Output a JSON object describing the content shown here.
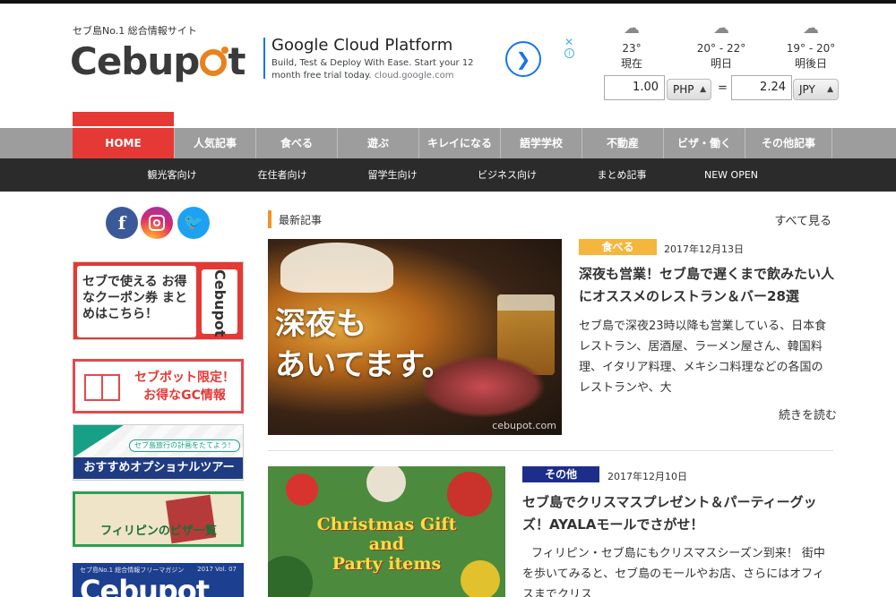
{
  "header": {
    "tagline": "セブ島No.1 総合情報サイト",
    "logo_pre": "Cebup",
    "logo_post": "t"
  },
  "ad": {
    "title": "Google Cloud Platform",
    "body": "Build, Test & Deploy With Ease. Start your 12 month free trial today.",
    "url": "cloud.google.com",
    "arrow_icon": "chevron-right-icon",
    "close_label": "✕",
    "info_label": "i"
  },
  "weather": [
    {
      "icon": "cloud-rain-icon",
      "temp": "23°",
      "label": "現在"
    },
    {
      "icon": "cloud-rain-icon",
      "temp": "20° - 22°",
      "label": "明日"
    },
    {
      "icon": "cloud-thunder-icon",
      "temp": "19° - 20°",
      "label": "明後日"
    }
  ],
  "converter": {
    "from_value": "1.00",
    "from_currency": "PHP",
    "equals": "=",
    "to_value": "2.24",
    "to_currency": "JPY"
  },
  "main_nav": [
    "HOME",
    "人気記事",
    "食べる",
    "遊ぶ",
    "キレイになる",
    "語学学校",
    "不動産",
    "ビザ・働く",
    "その他記事"
  ],
  "sub_nav": [
    "観光客向け",
    "在住者向け",
    "留学生向け",
    "ビジネス向け",
    "まとめ記事",
    "NEW OPEN"
  ],
  "sidebar": {
    "social": {
      "facebook": "f",
      "twitter": "🐦"
    },
    "coupon_text": "セブで使える お得なクーポン券 まとめはこちら！",
    "coupon_vert": "Cebupot",
    "gc_text": "セブポット限定！ お得なGC情報",
    "tour_pill": "セブ島旅行の計画をたてよう！",
    "tour_text": "おすすめオプショナルツアー",
    "visa_text": "フィリピンのビザ一覧",
    "mag_small": "セブ島No.1 総合情報フリーマガジン",
    "mag_vol": "2017 Vol. 07",
    "mag_title": "Cebupot"
  },
  "section": {
    "label": "最新記事",
    "see_all": "すべて見る"
  },
  "articles": [
    {
      "category": "食べる",
      "category_color": "#f4b63c",
      "date": "2017年12月13日",
      "title": "深夜も営業！セブ島で遅くまで飲みたい人にオススメのレストラン＆バー28選",
      "excerpt": "セブ島で深夜23時以降も営業している、日本食レストラン、居酒屋、ラーメン屋さん、韓国料理、イタリア料理、メキシコ料理などの各国のレストランや、大",
      "more": "続きを読む",
      "thumb_text_1": "深夜も",
      "thumb_text_2": "あいてます。",
      "thumb_watermark": "cebupot.com"
    },
    {
      "category": "その他",
      "category_color": "#1c2d8c",
      "date": "2017年12月10日",
      "title": "セブ島でクリスマスプレゼント＆パーティーグッズ！AYALAモールでさがせ！",
      "excerpt": "フィリピン・セブ島にもクリスマスシーズン到来！ 街中を歩いてみると、セブ島のモールやお店、さらにはオフィスまでクリス",
      "thumb_text_1": "Christmas Gift",
      "thumb_text_2": "and",
      "thumb_text_3": "Party items"
    }
  ]
}
